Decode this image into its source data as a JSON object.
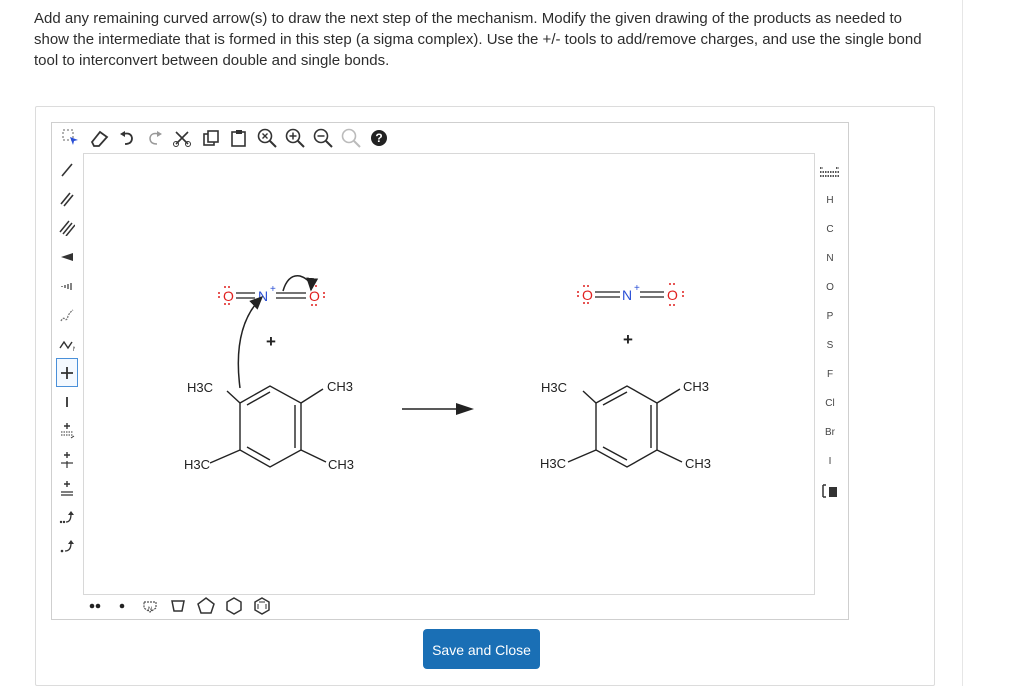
{
  "instructions": "Add any remaining curved arrow(s) to draw the next step of the mechanism. Modify the given drawing of the products as needed to show the intermediate that is formed in this step (a sigma complex). Use the +/- tools to add/remove charges, and use the single bond tool to interconvert between double and single bonds.",
  "top_toolbar": [
    "select-lasso-icon",
    "eraser-icon",
    "undo-icon",
    "redo-icon",
    "cut-icon",
    "copy-icon",
    "paste-icon",
    "zoom-fit-icon",
    "zoom-in-icon",
    "zoom-out-icon",
    "clean-icon",
    "help-icon"
  ],
  "left_toolbar": [
    "single-bond-icon",
    "double-bond-icon",
    "triple-bond-icon",
    "wedge-bond-icon",
    "hash-bond-icon",
    "wavy-bond-icon",
    "chain-icon",
    "plus-charge-icon",
    "minus-charge-icon",
    "radical-plus-icon",
    "radical-minus-icon",
    "radical-dot-icon",
    "curved-arrow-pair-icon",
    "curved-arrow-single-icon"
  ],
  "elements": [
    "H",
    "C",
    "N",
    "O",
    "P",
    "S",
    "F",
    "Cl",
    "Br",
    "I"
  ],
  "bottom_toolbar": [
    "lone-pair-icon",
    "radical-icon",
    "ring-template-icon",
    "cyclobutane-icon",
    "cyclopentane-icon",
    "cyclohexane-icon",
    "benzene-icon"
  ],
  "reactant": {
    "nitronium_O_left": "O",
    "nitronium_N": "N",
    "nitronium_N_charge": "+",
    "nitronium_O_right": "O",
    "plus_sign": "+",
    "sub_top_left": "H3C",
    "sub_top_right": "CH3",
    "sub_bottom_left": "H3C",
    "sub_bottom_right": "CH3"
  },
  "product": {
    "nitronium_O_left": "O",
    "nitronium_N": "N",
    "nitronium_N_charge": "+",
    "nitronium_O_right": "O",
    "plus_sign": "+",
    "sub_top_left": "H3C",
    "sub_top_right": "CH3",
    "sub_bottom_left": "H3C",
    "sub_bottom_right": "CH3"
  },
  "save_label": "Save and Close",
  "colors": {
    "accent": "#1a6fb5",
    "oxygen": "#e0201f",
    "nitrogen": "#2a4fd6",
    "bond": "#222222",
    "selected": "#4a90d9"
  }
}
